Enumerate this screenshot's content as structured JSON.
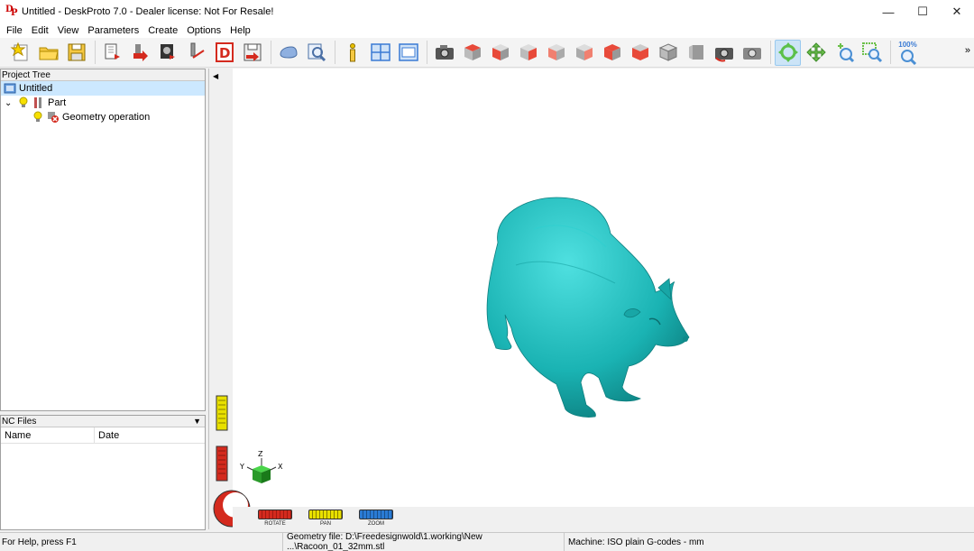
{
  "window": {
    "title": "Untitled - DeskProto 7.0 - Dealer license: Not For Resale!",
    "logo_letters": "DP",
    "minimize_glyph": "—",
    "maximize_glyph": "☐",
    "close_glyph": "✕"
  },
  "menu": [
    "File",
    "Edit",
    "View",
    "Parameters",
    "Create",
    "Options",
    "Help"
  ],
  "toolbar": {
    "zoom_label": "100%",
    "overflow_glyph": "»"
  },
  "project_tree": {
    "header": "Project Tree",
    "root": "Untitled",
    "part": "Part",
    "operation": "Geometry operation"
  },
  "nc_files": {
    "header": "NC Files",
    "col_name": "Name",
    "col_date": "Date"
  },
  "viewport": {
    "axes": {
      "x": "X",
      "y": "Y",
      "z": "Z"
    },
    "modes": [
      {
        "label": "ROTATE",
        "color": "#d42a1e"
      },
      {
        "label": "PAN",
        "color": "#e8e000"
      },
      {
        "label": "ZOOM",
        "color": "#2a7bd4"
      }
    ],
    "model_color": "#1fb8b8"
  },
  "status": {
    "help": "For Help, press F1",
    "geometry": "Geometry file: D:\\Freedesignwold\\1.working\\New ...\\Racoon_01_32mm.stl",
    "machine": "Machine: ISO plain G-codes - mm"
  }
}
